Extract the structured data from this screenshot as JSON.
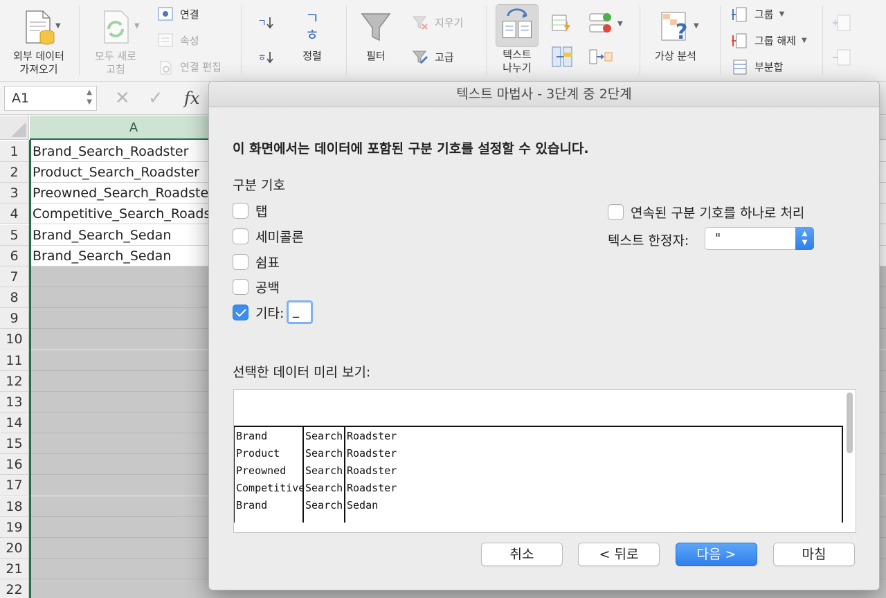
{
  "ribbon": {
    "get_external_data": "외부 데이터\n가져오기",
    "refresh_all": "모두 새로\n고침",
    "connections": "연결",
    "properties": "속성",
    "edit_links": "연결 편집",
    "sort_label": "정렬",
    "sort_az_glyph": "ㄱ",
    "sort_za_glyph": "ㅎ",
    "sort_icon_glyphs": "ㄱ\nㅎ",
    "filter": "필터",
    "clear": "지우기",
    "advanced": "고급",
    "text_to_columns": "텍스트\n나누기",
    "what_if": "가상 분석",
    "group": "그룹",
    "ungroup": "그룹 해제",
    "subtotal": "부분합"
  },
  "formula_bar": {
    "name_box": "A1",
    "fx": "fx"
  },
  "grid": {
    "column_header": "A",
    "rows": [
      {
        "num": "1",
        "value": "Brand_Search_Roadster"
      },
      {
        "num": "2",
        "value": "Product_Search_Roadster"
      },
      {
        "num": "3",
        "value": "Preowned_Search_Roadster"
      },
      {
        "num": "4",
        "value": "Competitive_Search_Roadster"
      },
      {
        "num": "5",
        "value": "Brand_Search_Sedan"
      },
      {
        "num": "6",
        "value": "Brand_Search_Sedan"
      },
      {
        "num": "7",
        "value": ""
      },
      {
        "num": "8",
        "value": ""
      },
      {
        "num": "9",
        "value": ""
      },
      {
        "num": "10",
        "value": ""
      },
      {
        "num": "11",
        "value": ""
      },
      {
        "num": "12",
        "value": ""
      },
      {
        "num": "13",
        "value": ""
      },
      {
        "num": "14",
        "value": ""
      },
      {
        "num": "15",
        "value": ""
      },
      {
        "num": "16",
        "value": ""
      },
      {
        "num": "17",
        "value": ""
      },
      {
        "num": "18",
        "value": ""
      },
      {
        "num": "19",
        "value": ""
      },
      {
        "num": "20",
        "value": ""
      },
      {
        "num": "21",
        "value": ""
      },
      {
        "num": "22",
        "value": ""
      }
    ]
  },
  "dialog": {
    "title": "텍스트 마법사 - 3단계 중 2단계",
    "heading": "이 화면에서는 데이터에 포함된 구분 기호를 설정할 수 있습니다.",
    "delimiters_label": "구분 기호",
    "tab": {
      "label": "탭",
      "checked": false
    },
    "semicolon": {
      "label": "세미콜론",
      "checked": false
    },
    "comma": {
      "label": "쉼표",
      "checked": false
    },
    "space": {
      "label": "공백",
      "checked": false
    },
    "other": {
      "label": "기타:",
      "checked": true,
      "value": "_"
    },
    "consecutive": {
      "label": "연속된 구분 기호를 하나로 처리",
      "checked": false
    },
    "qualifier_label": "텍스트 한정자:",
    "qualifier_value": "\"",
    "preview_label": "선택한 데이터 미리 보기:",
    "preview_rows": [
      [
        "Brand",
        "Search",
        "Roadster"
      ],
      [
        "Product",
        "Search",
        "Roadster"
      ],
      [
        "Preowned",
        "Search",
        "Roadster"
      ],
      [
        "Competitive",
        "Search",
        "Roadster"
      ],
      [
        "Brand",
        "Search",
        "Sedan"
      ]
    ],
    "buttons": {
      "cancel": "취소",
      "back": "< 뒤로",
      "next": "다음 >",
      "finish": "마침"
    }
  },
  "colors": {
    "accent_blue": "#2f80ec",
    "excel_green": "#1f7244"
  }
}
